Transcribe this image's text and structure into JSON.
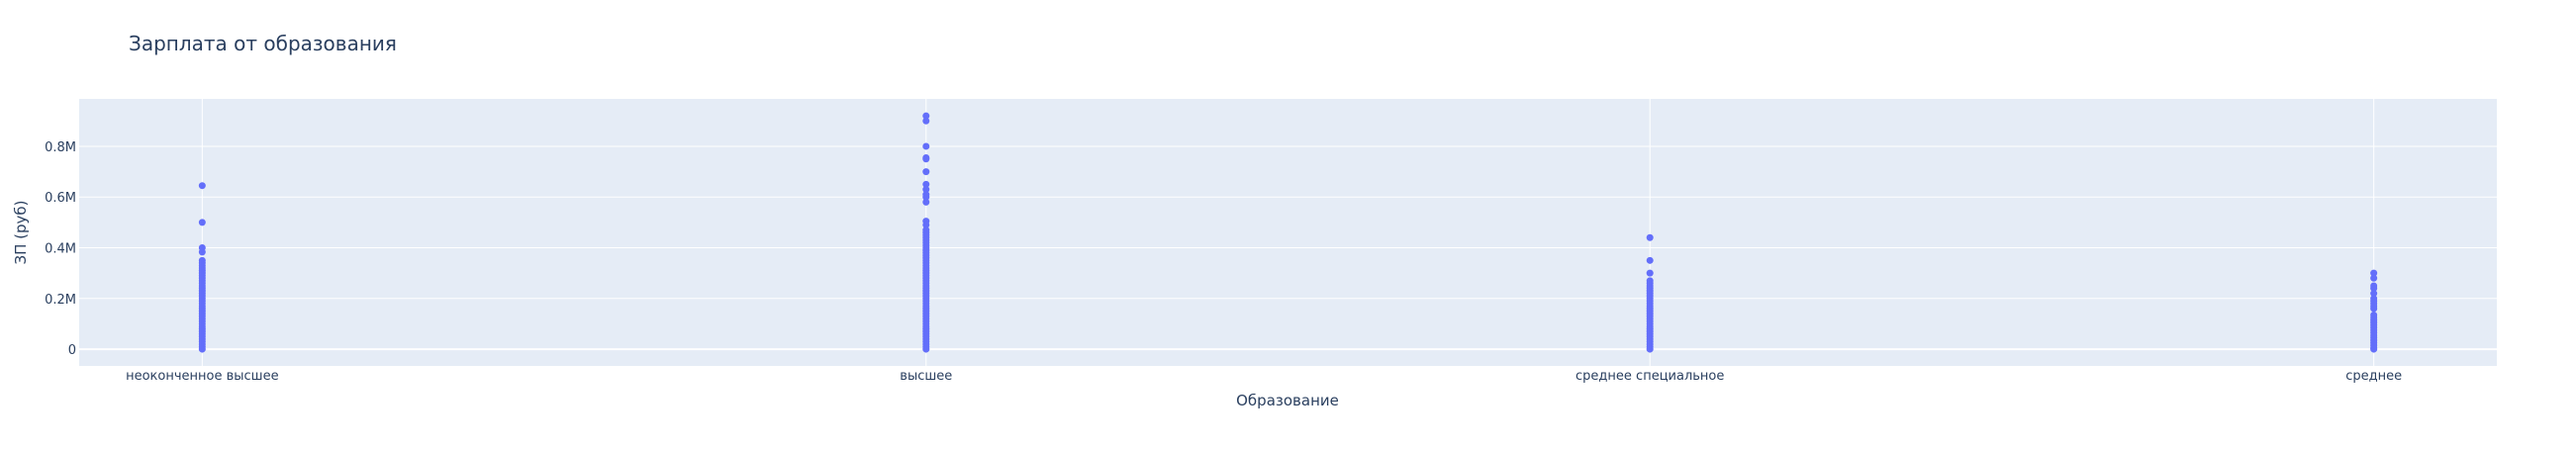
{
  "chart_data": {
    "type": "scatter",
    "title": "Зарплата от образования",
    "xlabel": "Образование",
    "ylabel": "ЗП (руб)",
    "categories": [
      "неоконченное высшее",
      "высшее",
      "среднее специальное",
      "среднее"
    ],
    "ylim": [
      -66000,
      987000
    ],
    "yticks": [
      0,
      200000,
      400000,
      600000,
      800000
    ],
    "ytick_labels": [
      "0",
      "0.2M",
      "0.4M",
      "0.6M",
      "0.8M"
    ],
    "grid": true,
    "legend": "none",
    "marker_color": "#636efa",
    "plot_bg": "#e5ecf6",
    "series": [
      {
        "category": "неоконченное высшее",
        "values": [
          645000,
          500000,
          400000,
          383000,
          350000,
          340000,
          330000,
          320000,
          310000,
          300000,
          290000,
          280000,
          270000,
          260000,
          250000,
          240000,
          230000,
          220000,
          210000,
          200000,
          190000,
          180000,
          170000,
          160000,
          150000,
          140000,
          130000,
          120000,
          110000,
          100000,
          90000,
          80000,
          70000,
          60000,
          50000,
          40000,
          30000,
          20000,
          10000,
          0
        ]
      },
      {
        "category": "высшее",
        "values": [
          920000,
          900000,
          800000,
          755000,
          750000,
          700000,
          650000,
          630000,
          610000,
          600000,
          580000,
          505000,
          490000,
          470000,
          460000,
          450000,
          440000,
          430000,
          420000,
          410000,
          400000,
          390000,
          380000,
          370000,
          360000,
          350000,
          340000,
          330000,
          320000,
          310000,
          300000,
          290000,
          280000,
          270000,
          260000,
          250000,
          240000,
          230000,
          220000,
          210000,
          200000,
          190000,
          180000,
          170000,
          160000,
          150000,
          140000,
          130000,
          120000,
          110000,
          100000,
          90000,
          80000,
          70000,
          60000,
          50000,
          40000,
          30000,
          20000,
          10000,
          0
        ]
      },
      {
        "category": "среднее специальное",
        "values": [
          440000,
          350000,
          300000,
          270000,
          260000,
          250000,
          240000,
          230000,
          220000,
          210000,
          200000,
          190000,
          180000,
          170000,
          160000,
          150000,
          140000,
          130000,
          120000,
          110000,
          100000,
          90000,
          80000,
          70000,
          60000,
          50000,
          40000,
          30000,
          20000,
          10000,
          0
        ]
      },
      {
        "category": "среднее",
        "values": [
          300000,
          280000,
          250000,
          240000,
          220000,
          200000,
          190000,
          180000,
          170000,
          160000,
          135000,
          125000,
          115000,
          105000,
          95000,
          85000,
          75000,
          65000,
          55000,
          45000,
          35000,
          25000,
          15000,
          5000,
          0
        ]
      }
    ]
  }
}
